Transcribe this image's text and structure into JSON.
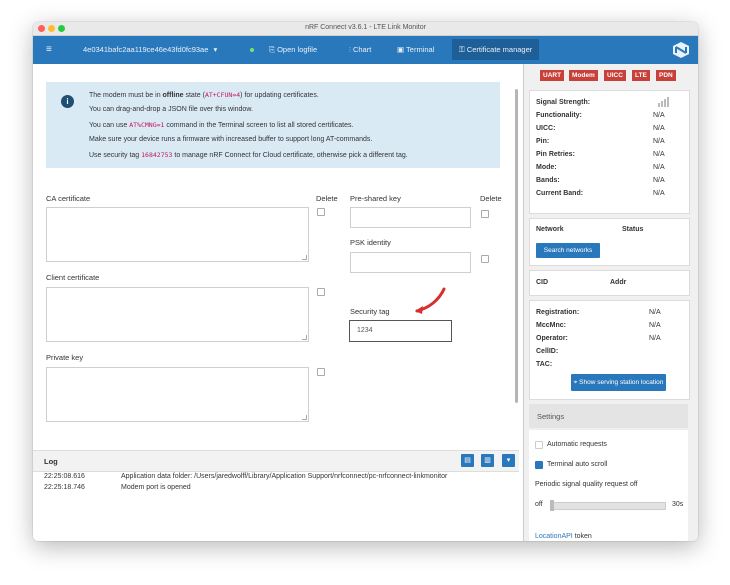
{
  "window": {
    "title": "nRF Connect v3.6.1 - LTE Link Monitor"
  },
  "navbar": {
    "menu_icon": "hamburger-icon",
    "device": "4e0341bafc2aa119ce46e43fd0fc93ae",
    "open_logfile": "Open logfile",
    "chart": "Chart",
    "terminal": "Terminal",
    "cert_manager": "Certificate manager"
  },
  "info": {
    "l1_pre": "The modem must be in ",
    "l1_bold": "offline",
    "l1_mid": " state (",
    "l1_code": "AT+CFUN=4",
    "l1_post": ") for updating certificates.",
    "l2": "You can drag-and-drop a JSON file over this window.",
    "l3_pre": "You can use ",
    "l3_code": "AT%CMNG=1",
    "l3_post": " command in the Terminal screen to list all stored certificates.",
    "l4": "Make sure your device runs a firmware with increased buffer to support long AT-commands.",
    "l5_pre": "Use security tag ",
    "l5_code": "16842753",
    "l5_post": " to manage nRF Connect for Cloud certificate, otherwise pick a different tag."
  },
  "form": {
    "ca_label": "CA certificate",
    "client_label": "Client certificate",
    "private_label": "Private key",
    "delete1": "Delete",
    "delete2": "Delete",
    "psk_label": "Pre-shared key",
    "pskid_label": "PSK identity",
    "sectag_label": "Security tag",
    "sectag_value": "1234"
  },
  "log": {
    "title": "Log",
    "rows": [
      {
        "time": "22:25:08.616",
        "msg": "Application data folder: /Users/jaredwolff/Library/Application Support/nrfconnect/pc-nrfconnect-linkmonitor"
      },
      {
        "time": "22:25:18.746",
        "msg": "Modem port is opened"
      }
    ]
  },
  "sidebar": {
    "badges": [
      "UART",
      "Modem",
      "UICC",
      "LTE",
      "PDN"
    ],
    "status": [
      {
        "k": "Signal Strength:",
        "v": ""
      },
      {
        "k": "Functionality:",
        "v": "N/A"
      },
      {
        "k": "UICC:",
        "v": "N/A"
      },
      {
        "k": "Pin:",
        "v": "N/A"
      },
      {
        "k": "Pin Retries:",
        "v": "N/A"
      },
      {
        "k": "Mode:",
        "v": "N/A"
      },
      {
        "k": "Bands:",
        "v": "N/A"
      },
      {
        "k": "Current Band:",
        "v": "N/A"
      }
    ],
    "network_col": "Network",
    "status_col": "Status",
    "search_btn": "Search networks",
    "cid_col": "CID",
    "addr_col": "Addr",
    "reg": [
      {
        "k": "Registration:",
        "v": "N/A"
      },
      {
        "k": "MccMnc:",
        "v": "N/A"
      },
      {
        "k": "Operator:",
        "v": "N/A"
      },
      {
        "k": "CellID:",
        "v": ""
      },
      {
        "k": "TAC:",
        "v": ""
      }
    ],
    "map_btn": "Show serving station location",
    "settings_title": "Settings",
    "auto_requests": "Automatic requests",
    "auto_scroll": "Terminal auto scroll",
    "periodic_label": "Periodic signal quality request off",
    "slider_min": "off",
    "slider_max": "30s",
    "footer_pre": "LocationAPI",
    "footer_post": " token"
  },
  "colors": {
    "accent": "#2a78bc",
    "badge": "#c8403a",
    "info_bg": "#daeaf5"
  }
}
